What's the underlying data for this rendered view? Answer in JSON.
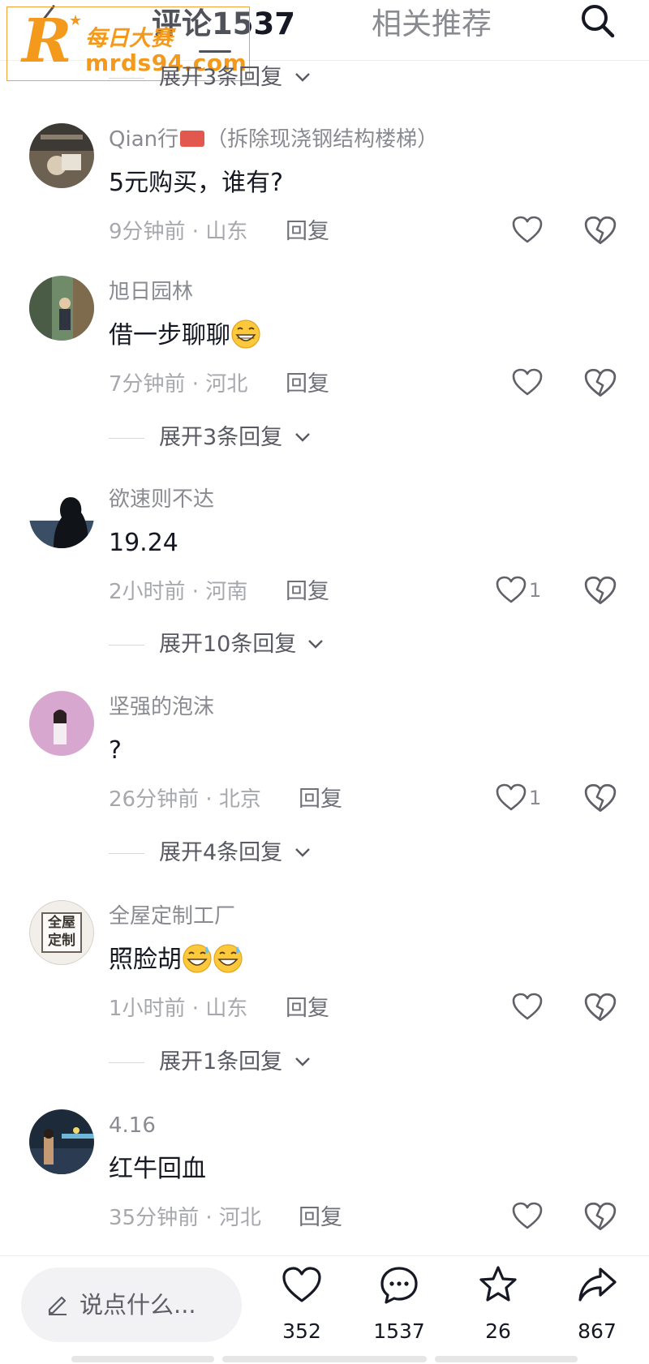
{
  "header": {
    "tab_comments": "评论1537",
    "tab_related": "相关推荐"
  },
  "watermark": {
    "letter": "R",
    "name": "每日大赛",
    "url": "mrds94.com"
  },
  "top_expand": "展开3条回复",
  "comments": [
    {
      "username": "Qian行",
      "username_suffix": "（拆除现浇钢结构楼梯）",
      "text": "5元购买，谁有?",
      "meta": "9分钟前 · 山东",
      "reply": "回复",
      "likes": "",
      "expand": ""
    },
    {
      "username": "旭日园林",
      "text": "借一步聊聊",
      "emoji": [
        "grin"
      ],
      "meta": "7分钟前 · 河北",
      "reply": "回复",
      "likes": "",
      "expand": "展开3条回复"
    },
    {
      "username": "欲速则不达",
      "text": "19.24",
      "meta": "2小时前 · 河南",
      "reply": "回复",
      "likes": "1",
      "expand": "展开10条回复"
    },
    {
      "username": "坚强的泡沫",
      "text": "?",
      "meta": "26分钟前 · 北京",
      "reply": "回复",
      "likes": "1",
      "expand": "展开4条回复"
    },
    {
      "username": "全屋定制工厂",
      "avatar_text": [
        "全屋",
        "定制"
      ],
      "text": "照脸胡",
      "emoji": [
        "sweat-grin",
        "sweat-grin"
      ],
      "meta": "1小时前 · 山东",
      "reply": "回复",
      "likes": "",
      "expand": "展开1条回复"
    },
    {
      "username": "4.16",
      "text": "红牛回血",
      "meta": "35分钟前 · 河北",
      "reply": "回复",
      "likes": "",
      "expand": ""
    }
  ],
  "bottom_bar": {
    "input_placeholder": "说点什么...",
    "likes": "352",
    "comments": "1537",
    "favorites": "26",
    "shares": "867"
  },
  "colors": {
    "accent_watermark": "#f39a1d",
    "text_primary": "#161823",
    "text_secondary": "#8a8b91",
    "flag_red": "#e2584f"
  }
}
